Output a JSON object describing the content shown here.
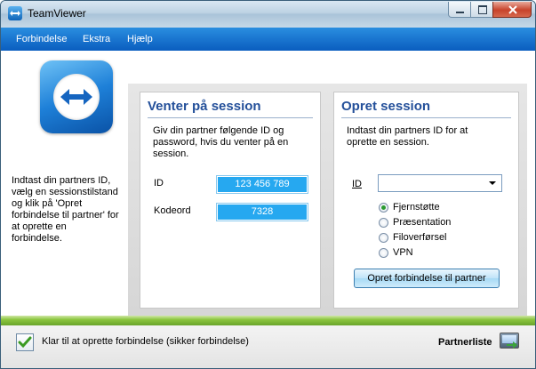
{
  "window": {
    "title": "TeamViewer",
    "controls": {
      "minimize": "minimize",
      "maximize": "maximize",
      "close": "close"
    }
  },
  "menu": {
    "items": [
      {
        "label": "Forbindelse"
      },
      {
        "label": "Ekstra"
      },
      {
        "label": "Hjælp"
      }
    ]
  },
  "left": {
    "instructions": "Indtast din partners ID,\nvælg en sessionstilstand\nog klik på 'Opret\nforbindelse til partner' for\nat oprette en\nforbindelse."
  },
  "waiting": {
    "title": "Venter på session",
    "description": "Giv din partner følgende ID og\npassword, hvis du venter på en\nsession.",
    "id_label": "ID",
    "id_value": "123 456 789",
    "password_label": "Kodeord",
    "password_value": "7328"
  },
  "create": {
    "title": "Opret session",
    "description": "Indtast din partners ID for at\noprette en session.",
    "id_label": "ID",
    "id_value": "",
    "modes": [
      {
        "label": "Fjernstøtte",
        "selected": true
      },
      {
        "label": "Præsentation",
        "selected": false
      },
      {
        "label": "Filoverførsel",
        "selected": false
      },
      {
        "label": "VPN",
        "selected": false
      }
    ],
    "connect_button": "Opret forbindelse til partner"
  },
  "status": {
    "text": "Klar til at oprette forbindelse (sikker forbindelse)",
    "partner_list": "Partnerliste"
  },
  "colors": {
    "menubar": "#0a5dbf",
    "title_blue": "#24509a",
    "value_box": "#26a8f0",
    "status_green": "#8cc63f"
  },
  "icons": {
    "app": "teamviewer-logo-icon",
    "status": "check-icon",
    "partner": "partner-list-icon",
    "dropdown": "chevron-down-icon"
  }
}
